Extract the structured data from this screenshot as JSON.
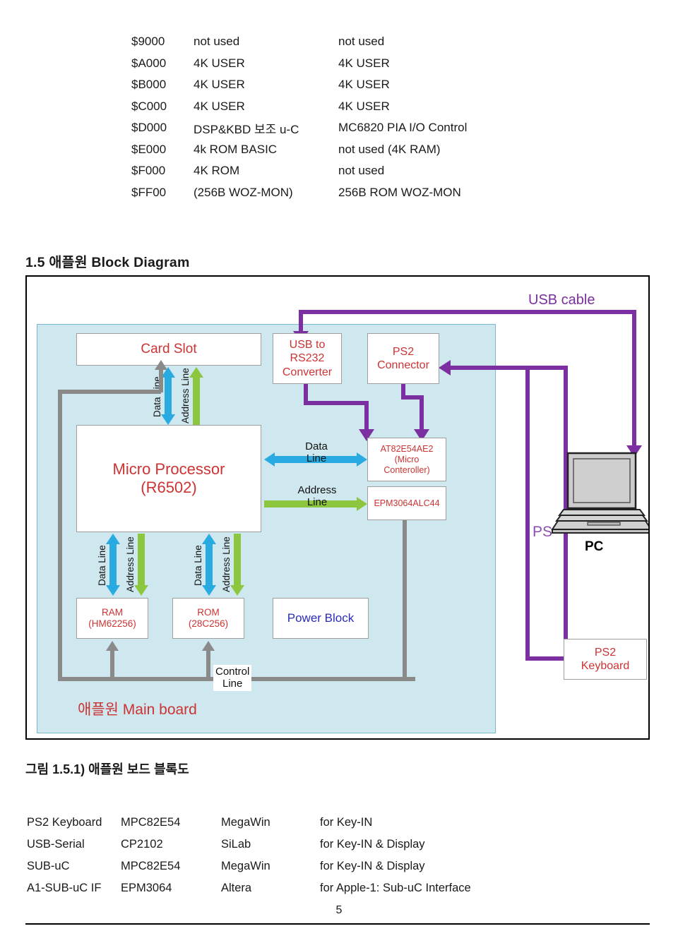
{
  "memory_map": {
    "rows": [
      {
        "address": "$9000",
        "left": "not used",
        "right": "not used"
      },
      {
        "address": "$A000",
        "left": "4K USER",
        "right": "4K USER"
      },
      {
        "address": "$B000",
        "left": "4K USER",
        "right": "4K USER"
      },
      {
        "address": "$C000",
        "left": "4K USER",
        "right": "4K USER"
      },
      {
        "address": "$D000",
        "left": "DSP&KBD 보조 u-C",
        "right": "MC6820 PIA I/O Control"
      },
      {
        "address": "$E000",
        "left": "4k ROM BASIC",
        "right": "not used (4K RAM)"
      },
      {
        "address": "$F000",
        "left": "4K ROM",
        "right": "not used"
      },
      {
        "address": "$FF00",
        "left": "(256B WOZ-MON)",
        "right": "256B ROM WOZ-MON"
      }
    ]
  },
  "section": {
    "heading": "1.5 애플원 Block Diagram"
  },
  "diagram": {
    "usb_cable_label": "USB cable",
    "mainboard_caption": "애플원 Main board",
    "ps2_pc_label": "PS",
    "pc_label": "PC",
    "boxes": {
      "card_slot": "Card Slot",
      "usb_to_rs232": [
        "USB to",
        "RS232",
        "Converter"
      ],
      "ps2_connector": [
        "PS2",
        "Connector"
      ],
      "micro_processor": [
        "Micro Processor",
        "(R6502)"
      ],
      "at82e54ae2": [
        "AT82E54AE2",
        "(Micro",
        "Conteroller)"
      ],
      "epm3064alc44": "EPM3064ALC44",
      "ram": [
        "RAM",
        "(HM62256)"
      ],
      "rom": [
        "ROM",
        "(28C256)"
      ],
      "power_block": "Power Block",
      "ps2_keyboard": [
        "PS2",
        "Keyboard"
      ]
    },
    "bus_labels": {
      "data_line": "Data\nLine",
      "address_line": "Address\nLine",
      "control_line": "Control\nLine",
      "data": "Data",
      "line": "Line",
      "address": "Address"
    },
    "colors": {
      "data_line": "#29abe2",
      "address_line": "#8cc63e",
      "control_line": "#8a8a8a",
      "usb_cable": "#7b2fa0",
      "mainboard_fill": "#cfe7ee",
      "box_text_red": "#cc3333",
      "box_text_blue": "#2b2bbb"
    }
  },
  "figure_caption": "그림 1.5.1) 애플원 보드 블록도",
  "parts_table": {
    "rows": [
      {
        "interface": "PS2 Keyboard",
        "part": "MPC82E54",
        "vendor": "MegaWin",
        "purpose": "for Key-IN"
      },
      {
        "interface": "USB-Serial",
        "part": "CP2102",
        "vendor": "SiLab",
        "purpose": "for Key-IN & Display"
      },
      {
        "interface": "SUB-uC",
        "part": "MPC82E54",
        "vendor": "MegaWin",
        "purpose": "for Key-IN & Display"
      },
      {
        "interface": "A1-SUB-uC IF",
        "part": "EPM3064",
        "vendor": "Altera",
        "purpose": "for Apple-1: Sub-uC Interface"
      }
    ]
  },
  "footer": {
    "page_number": "5"
  }
}
